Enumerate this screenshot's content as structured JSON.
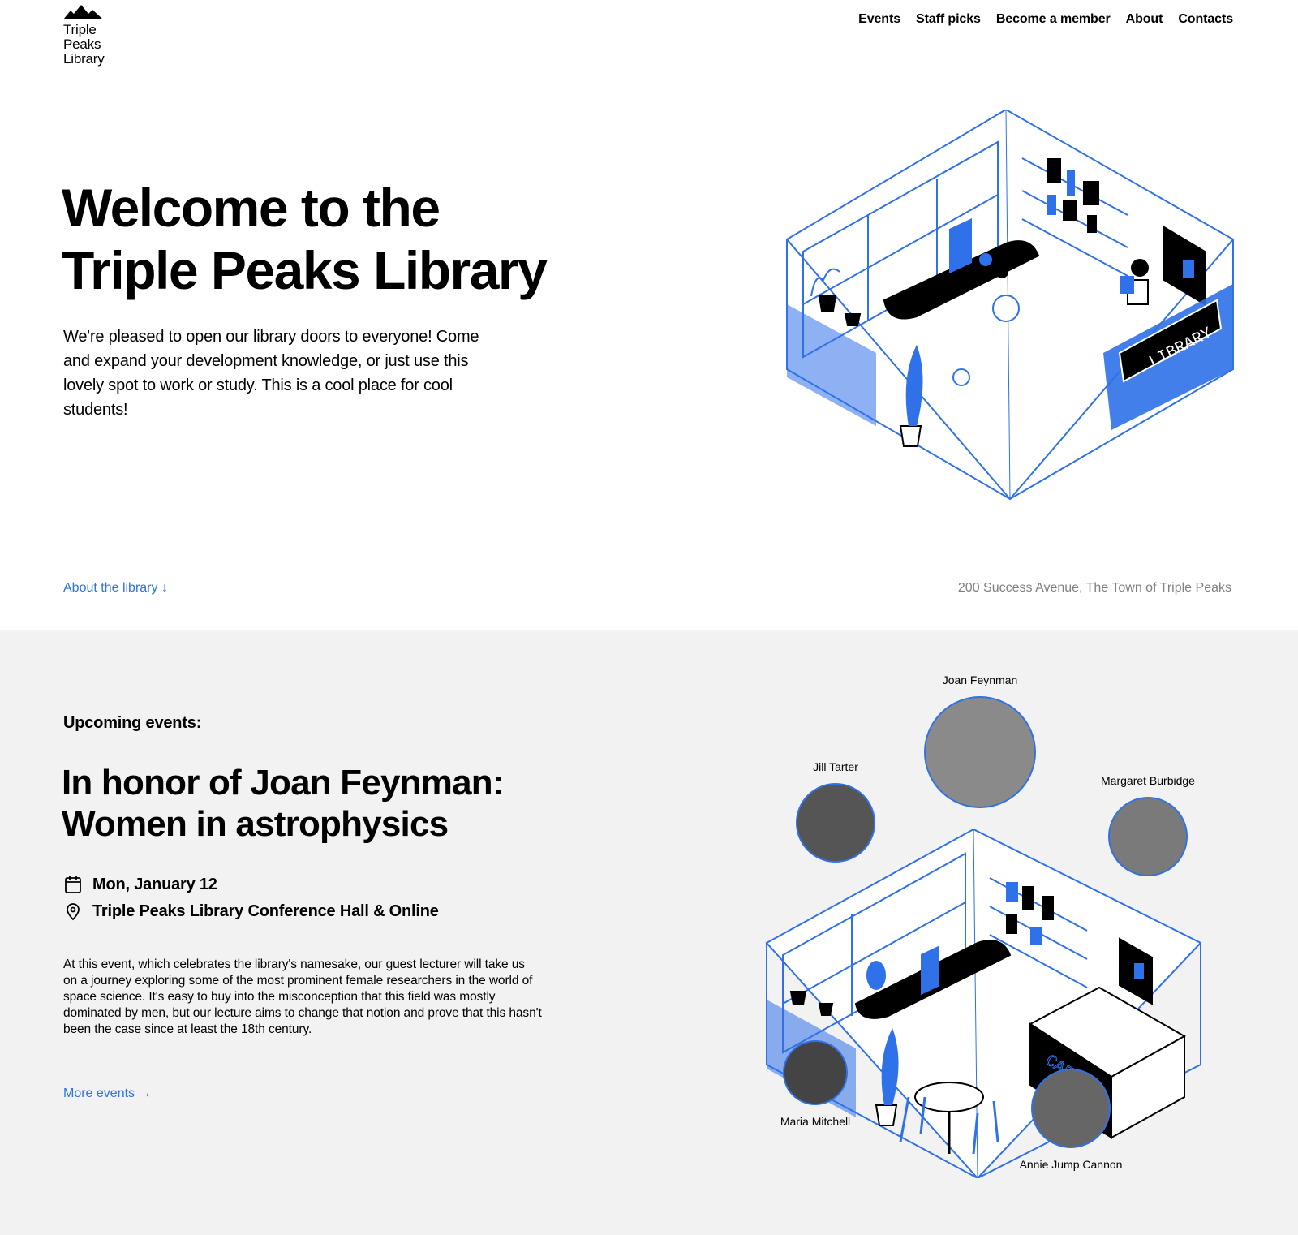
{
  "brand": {
    "name_lines": [
      "Triple",
      "Peaks",
      "Library"
    ],
    "accent_color": "#2f71e8"
  },
  "nav": {
    "items": [
      "Events",
      "Staff picks",
      "Become a member",
      "About",
      "Contacts"
    ]
  },
  "hero": {
    "title_lines": [
      "Welcome to the",
      "Triple Peaks Library"
    ],
    "text": "We're pleased to open our library doors to everyone! Come and expand your development knowledge, or just use this lovely spot to work or study. This is a cool place for cool students!",
    "about_link": "About the library ↓",
    "address": "200 Success Avenue, The Town of Triple Peaks",
    "illustration": {
      "sign_text": "LIBRARY"
    }
  },
  "events": {
    "label": "Upcoming events:",
    "title_lines": [
      "In honor of Joan Feynman:",
      "Women in astrophysics"
    ],
    "date": "Mon, January 12",
    "place": "Triple Peaks Library Conference Hall & Online",
    "description": "At this event, which celebrates the library's namesake, our guest lecturer will take us on a journey exploring some of the most prominent female researchers in the world of space science. It's easy to buy into the misconception that this field was mostly dominated by men, but our lecture aims to change that notion and prove that this hasn't been the case since at least the 18th century.",
    "more_link": "More events →",
    "illustration": {
      "sign_text": "CAFE"
    },
    "speakers": [
      "Joan Feynman",
      "Jill Tarter",
      "Margaret Burbidge",
      "Maria Mitchell",
      "Annie Jump Cannon"
    ]
  }
}
